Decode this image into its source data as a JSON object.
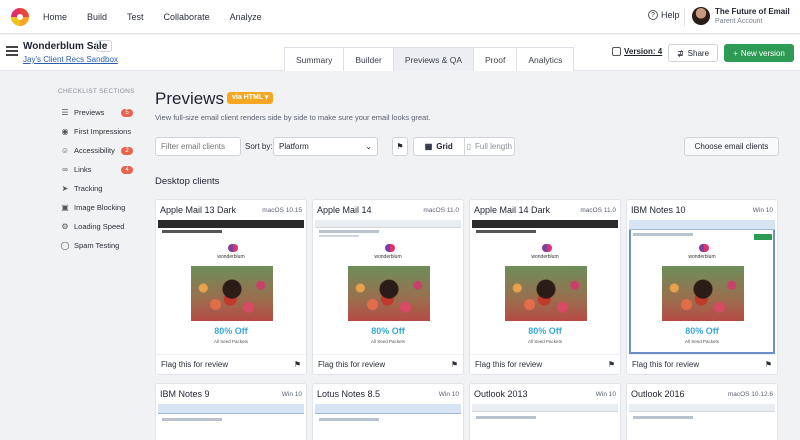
{
  "nav": {
    "links": [
      "Home",
      "Build",
      "Test",
      "Collaborate",
      "Analyze"
    ],
    "help": "Help",
    "account_name": "The Future of Email",
    "account_sub": "Parent Account"
  },
  "project": {
    "name": "Wonderblum Sale",
    "more": "···",
    "sandbox": "Jay's Client Recs Sandbox",
    "tabs": [
      "Summary",
      "Builder",
      "Previews & QA",
      "Proof",
      "Analytics"
    ],
    "active_tab": "Previews & QA",
    "version_label": "Version: 4",
    "share": "Share",
    "new_version": "New version"
  },
  "sidebar": {
    "title": "CHECKLIST SECTIONS",
    "items": [
      {
        "label": "Previews",
        "icon": "list-icon",
        "badge": "5"
      },
      {
        "label": "First Impressions",
        "icon": "eye-icon",
        "badge": ""
      },
      {
        "label": "Accessibility",
        "icon": "accessibility-icon",
        "badge": "2"
      },
      {
        "label": "Links",
        "icon": "link-icon",
        "badge": "4"
      },
      {
        "label": "Tracking",
        "icon": "send-icon",
        "badge": ""
      },
      {
        "label": "Image Blocking",
        "icon": "image-icon",
        "badge": ""
      },
      {
        "label": "Loading Speed",
        "icon": "gear-icon",
        "badge": ""
      },
      {
        "label": "Spam Testing",
        "icon": "shield-icon",
        "badge": ""
      }
    ]
  },
  "main": {
    "title": "Previews",
    "via": "via HTML ▾",
    "description": "View full-size email client renders side by side to make sure your email looks great.",
    "filter_placeholder": "Filter email clients",
    "sort_label": "Sort by:",
    "sort_value": "Platform",
    "grid_label": "Grid",
    "full_length_label": "Full length",
    "choose_clients": "Choose email clients",
    "section_title": "Desktop clients",
    "flag_label": "Flag this for review",
    "email": {
      "brand": "wonderblum",
      "offer": "80% Off",
      "sub": "All Seed Packets"
    },
    "clients_row1": [
      {
        "name": "Apple Mail 13 Dark",
        "os": "macOS 10.15",
        "style": "dark"
      },
      {
        "name": "Apple Mail 14",
        "os": "macOS 11.0",
        "style": "light"
      },
      {
        "name": "Apple Mail 14 Dark",
        "os": "macOS 11.0",
        "style": "dark"
      },
      {
        "name": "IBM Notes 10",
        "os": "Win 10",
        "style": "ibm"
      }
    ],
    "clients_row2": [
      {
        "name": "IBM Notes 9",
        "os": "Win 10"
      },
      {
        "name": "Lotus Notes 8.5",
        "os": "Win 10"
      },
      {
        "name": "Outlook 2013",
        "os": "Win 10"
      },
      {
        "name": "Outlook 2016",
        "os": "macOS 10.12.6"
      }
    ]
  },
  "colors": {
    "accent_green": "#2e9b55",
    "badge_red": "#e9644f",
    "via_orange": "#f5a623",
    "offer_blue": "#3aa8d8"
  }
}
